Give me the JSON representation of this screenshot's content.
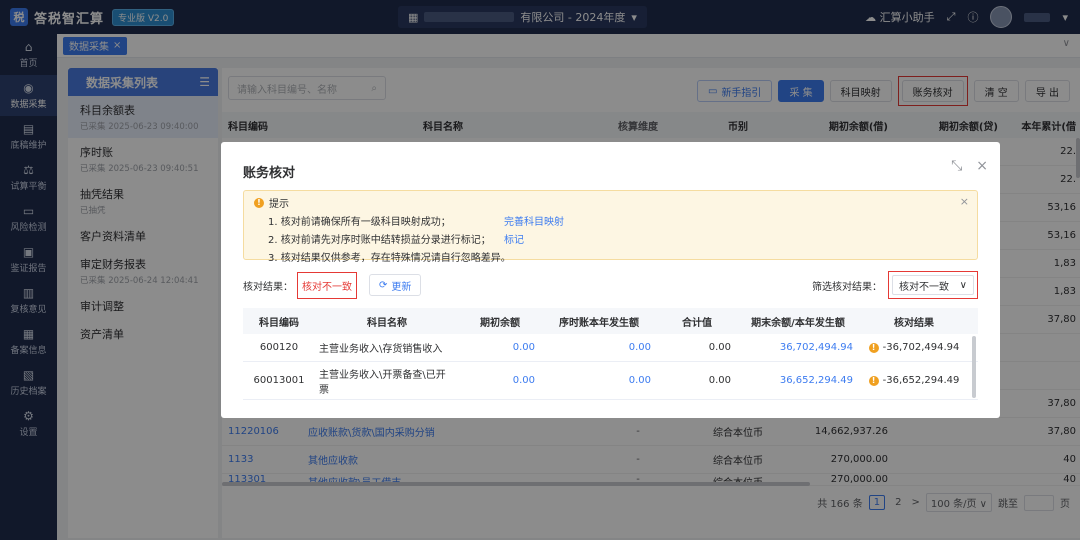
{
  "app": {
    "logo_mark": "税",
    "name": "答税智汇算",
    "edition": "专业版 V2.0",
    "company_suffix": "有限公司 - 2024年度",
    "assistant": "汇算小助手"
  },
  "sidebar": {
    "items": [
      {
        "icon": "⌂",
        "label": "首页"
      },
      {
        "icon": "◉",
        "label": "数据采集"
      },
      {
        "icon": "▤",
        "label": "底稿维护"
      },
      {
        "icon": "⚖",
        "label": "试算平衡"
      },
      {
        "icon": "▭",
        "label": "风险检测"
      },
      {
        "icon": "▣",
        "label": "鉴证报告"
      },
      {
        "icon": "▥",
        "label": "复核意见"
      },
      {
        "icon": "▦",
        "label": "备案信息"
      },
      {
        "icon": "▧",
        "label": "历史档案"
      },
      {
        "icon": "⚙",
        "label": "设置"
      }
    ]
  },
  "tabs": [
    {
      "label": "数据采集"
    }
  ],
  "left_panel": {
    "title": "数据采集列表",
    "items": [
      {
        "title": "科目余额表",
        "sub": "已采集 2025-06-23 09:40:00"
      },
      {
        "title": "序时账",
        "sub": "已采集 2025-06-23 09:40:51"
      },
      {
        "title": "抽凭结果",
        "sub": "已抽凭"
      },
      {
        "title": "客户资料清单",
        "sub": ""
      },
      {
        "title": "审定财务报表",
        "sub": "已采集 2025-06-24 12:04:41"
      },
      {
        "title": "审计调整",
        "sub": ""
      },
      {
        "title": "资产清单",
        "sub": ""
      }
    ]
  },
  "toolbar": {
    "search_placeholder": "请输入科目编号、名称",
    "guide": "新手指引",
    "collect": "采 集",
    "mapping": "科目映射",
    "reconcile": "账务核对",
    "clear": "清 空",
    "export": "导 出"
  },
  "bg_table": {
    "headers": [
      "科目编码",
      "科目名称",
      "核算维度",
      "币别",
      "期初余额(借)",
      "期初余额(贷)",
      "本年累计(借"
    ],
    "side_values": [
      "22.",
      "22.",
      "53,16",
      "53,16",
      "1,83",
      "1,83",
      "37,80",
      "",
      "",
      "37,80"
    ],
    "rows": [
      {
        "code": "11220106",
        "name": "应收账款\\货款\\国内采购分销",
        "dim": "-",
        "cur": "综合本位币",
        "debit": "14,662,937.26",
        "credit": "",
        "ytd": "37,80"
      },
      {
        "code": "1133",
        "name": "其他应收款",
        "dim": "-",
        "cur": "综合本位币",
        "debit": "270,000.00",
        "credit": "",
        "ytd": "40"
      },
      {
        "code": "113301",
        "name": "其他应收款\\员工借支",
        "dim": "-",
        "cur": "综合本位币",
        "debit": "270,000.00",
        "credit": "",
        "ytd": "40"
      }
    ]
  },
  "pagination": {
    "total": "共 166 条",
    "page1": "1",
    "page2": "2",
    "next": ">",
    "size": "100 条/页",
    "goto": "跳至",
    "page_suffix": "页"
  },
  "modal": {
    "title": "账务核对",
    "tip_title": "提示",
    "tips": [
      {
        "text": "1. 核对前请确保所有一级科目映射成功；",
        "link": "完善科目映射"
      },
      {
        "text": "2. 核对前请先对序时账中结转损益分录进行标记；",
        "link": "标记"
      },
      {
        "text": "3. 核对结果仅供参考，存在特殊情况请自行忽略差异。",
        "link": ""
      }
    ],
    "result_label": "核对结果：",
    "result_value": "核对不一致",
    "refresh": "更新",
    "filter_label": "筛选核对结果：",
    "filter_value": "核对不一致",
    "headers": [
      "科目编码",
      "科目名称",
      "期初余额",
      "序时账本年发生额",
      "合计值",
      "期末余额/本年发生额",
      "核对结果"
    ],
    "rows": [
      {
        "code": "600120",
        "name": "主营业务收入\\存货销售收入",
        "opening": "0.00",
        "journal": "0.00",
        "total": "0.00",
        "closing": "36,702,494.94",
        "result": "-36,702,494.94"
      },
      {
        "code": "60013001",
        "name": "主营业务收入\\开票备查\\已开票",
        "opening": "0.00",
        "journal": "0.00",
        "total": "0.00",
        "closing": "36,652,294.49",
        "result": "-36,652,294.49"
      }
    ]
  },
  "colors": {
    "accent": "#3d7cf0",
    "topbar": "#1f2d4e",
    "highlight": "#e53935",
    "warning": "#f0a020"
  }
}
